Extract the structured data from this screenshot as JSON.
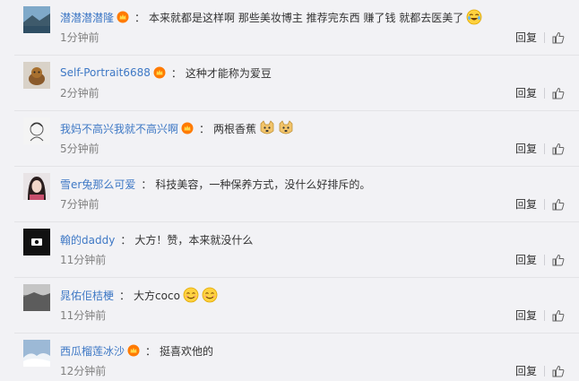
{
  "comments": [
    {
      "user": "潜潜潜潜隆",
      "has_vip": true,
      "text": "本来就都是这样啊 那些美妆博主 推荐完东西 赚了钱 就都去医美了",
      "emojis": [
        "laugh-tears-emoji"
      ],
      "time": "1分钟前",
      "reply": "回复",
      "avatar": "landscape"
    },
    {
      "user": "Self-Portrait6688",
      "has_vip": true,
      "text": "这种才能称为爱豆",
      "emojis": [],
      "time": "2分钟前",
      "reply": "回复",
      "avatar": "dog"
    },
    {
      "user": "我妈不高兴我就不高兴啊",
      "has_vip": true,
      "text": "两根香蕉",
      "emojis": [
        "doge-emoji",
        "doge-emoji"
      ],
      "time": "5分钟前",
      "reply": "回复",
      "avatar": "sketch"
    },
    {
      "user": "雪er兔那么可爱",
      "has_vip": false,
      "text": "科技美容，一种保养方式，没什么好排斥的。",
      "emojis": [],
      "time": "7分钟前",
      "reply": "回复",
      "avatar": "girl"
    },
    {
      "user": "翰的daddy",
      "has_vip": false,
      "text": "大方！赞，本来就没什么",
      "emojis": [],
      "time": "11分钟前",
      "reply": "回复",
      "avatar": "dark"
    },
    {
      "user": "晁佑佢桔梗",
      "has_vip": false,
      "text": "大方coco",
      "emojis": [
        "smile-emoji",
        "smile-emoji"
      ],
      "time": "11分钟前",
      "reply": "回复",
      "avatar": "grey"
    },
    {
      "user": "西瓜榴莲冰沙",
      "has_vip": true,
      "text": "挺喜欢他的",
      "emojis": [],
      "time": "12分钟前",
      "reply": "回复",
      "avatar": "sky"
    }
  ]
}
